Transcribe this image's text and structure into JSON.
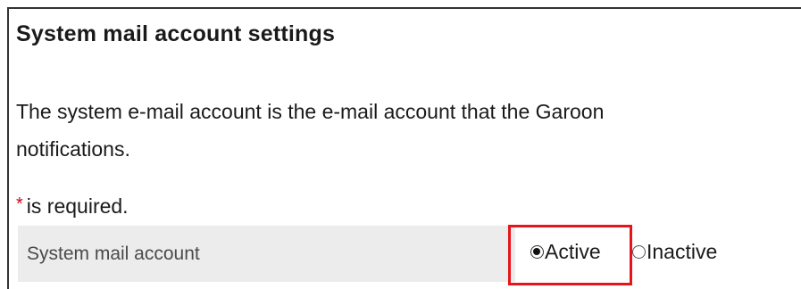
{
  "page": {
    "title": "System mail account settings",
    "description_line1": "The system e-mail account is the e-mail account that the Garoon",
    "description_line2": "notifications.",
    "required_asterisk": "*",
    "required_text": "is required."
  },
  "form": {
    "field_label": "System mail account",
    "options": [
      {
        "label": "Active",
        "selected": true
      },
      {
        "label": "Inactive",
        "selected": false
      }
    ]
  },
  "colors": {
    "required_asterisk": "#d0021b",
    "highlight_border": "#e8141c",
    "label_cell_bg": "#ececec"
  }
}
